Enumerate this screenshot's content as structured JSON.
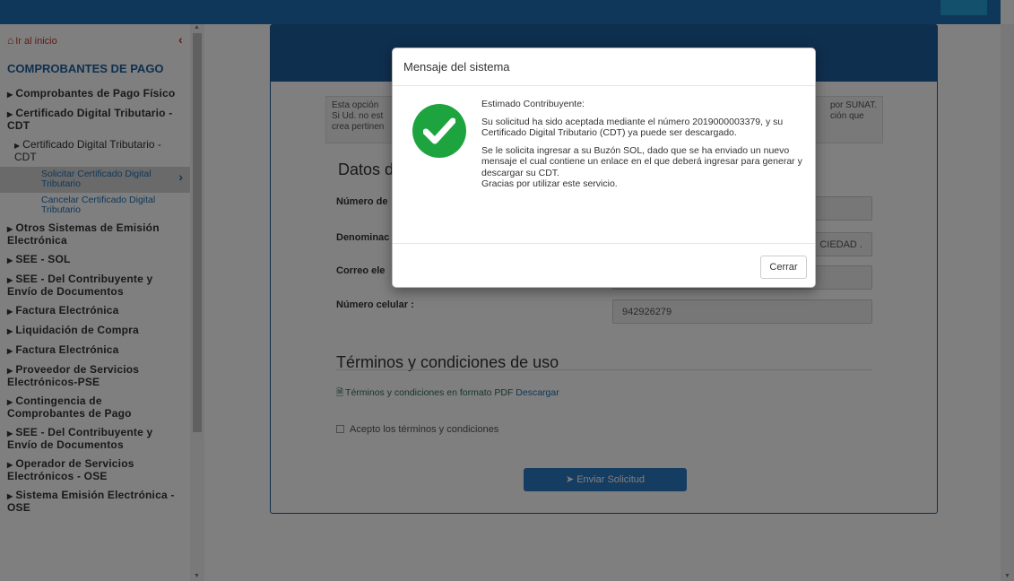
{
  "sidebar": {
    "home_label": "Ir al inicio",
    "section_title": "COMPROBANTES DE PAGO",
    "items": [
      {
        "label": "Comprobantes de Pago Físico"
      },
      {
        "label": "Certificado Digital Tributario - CDT"
      }
    ],
    "sub_item": {
      "label": "Certificado Digital Tributario - CDT"
    },
    "leaves": [
      {
        "label": "Solicitar Certificado Digital Tributario"
      },
      {
        "label": "Cancelar Certificado Digital Tributario"
      }
    ],
    "items_after": [
      {
        "label": "Otros Sistemas de Emisión Electrónica"
      },
      {
        "label": "SEE - SOL"
      },
      {
        "label": "SEE - Del Contribuyente y Envío de Documentos"
      },
      {
        "label": "Factura Electrónica"
      },
      {
        "label": "Liquidación de Compra"
      },
      {
        "label": "Factura Electrónica"
      },
      {
        "label": "Proveedor de Servicios Electrónicos-PSE"
      },
      {
        "label": "Contingencia de Comprobantes de Pago"
      },
      {
        "label": "SEE - Del Contribuyente y Envío de Documentos"
      },
      {
        "label": "Operador de Servicios Electrónicos - OSE"
      },
      {
        "label": "Sistema Emisión Electrónica - OSE"
      }
    ]
  },
  "form": {
    "notice_left": "Esta opción\nSi Ud. no est\ncrea pertinen",
    "notice_right": "por SUNAT.\nción que",
    "section_title": "Datos d",
    "labels": {
      "numero": "Número de",
      "denominacion": "Denominac",
      "correo": "Correo ele",
      "celular": "Número celular :"
    },
    "values": {
      "denominacion_tail": "CIEDAD .",
      "celular": "942926279"
    },
    "terms_title": "Términos y condiciones de uso",
    "terms_link_text": "Términos y condiciones en formato PDF",
    "terms_download": "Descargar",
    "accept_label": "Acepto los términos y condiciones",
    "send_button": "Enviar Solicitud"
  },
  "modal": {
    "title": "Mensaje del sistema",
    "greeting": "Estimado Contribuyente:",
    "paragraph1": "Su solicitud ha sido aceptada mediante el número 2019000003379, y su Certificado Digital Tributario (CDT) ya puede ser descargado.",
    "paragraph2": "Se le solicita ingresar a su Buzón SOL, dado que se ha enviado un nuevo mensaje el cual contiene un enlace en el que deberá ingresar para generar y descargar su CDT.",
    "paragraph3": "Gracias por utilizar este servicio.",
    "close_button": "Cerrar"
  },
  "colors": {
    "brand_blue": "#1f5e9e",
    "success_green": "#1ea43f",
    "home_red": "#c0392b"
  }
}
